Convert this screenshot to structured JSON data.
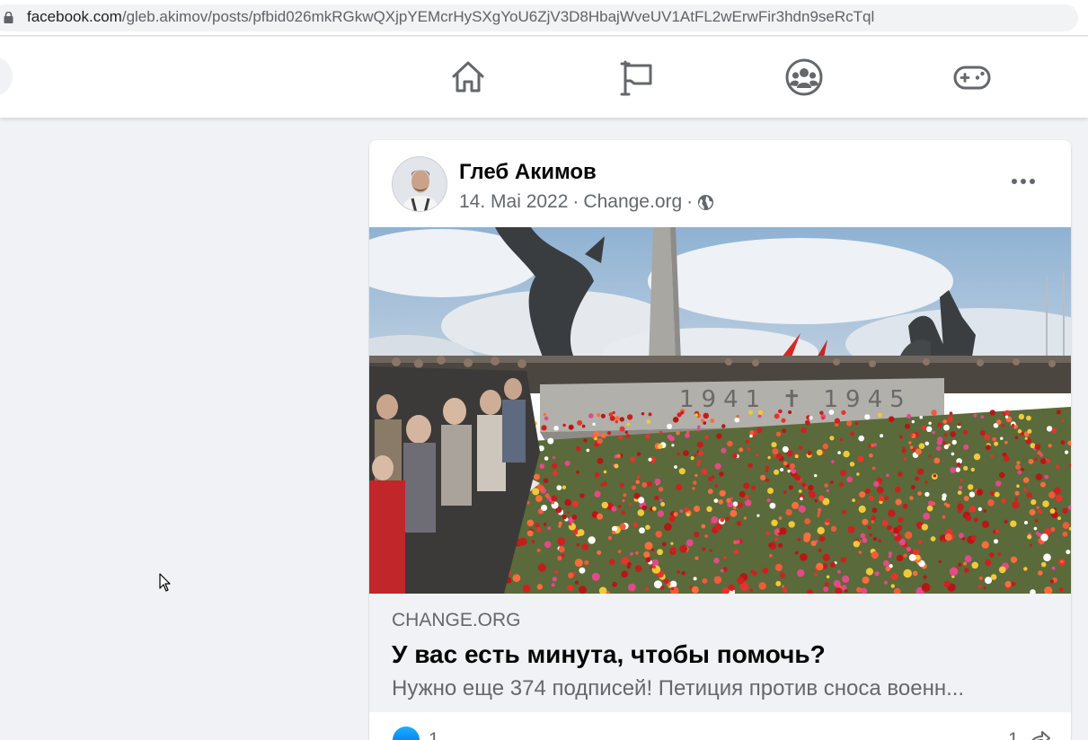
{
  "browser": {
    "url_host": "facebook.com",
    "url_path": "/gleb.akimov/posts/pfbid026mkRGkwQXjpYEMcrHySXgYoU6ZjV3D8HbajWveUV1AtFL2wErwFir3hdn9seRcTql"
  },
  "nav": {
    "icons": [
      "home-icon",
      "pages-flag-icon",
      "groups-icon",
      "gaming-icon"
    ]
  },
  "post": {
    "author": "Глеб Акимов",
    "date": "14. Mai 2022",
    "separator": "·",
    "source": "Change.org",
    "audience_icon": "globe-icon",
    "link": {
      "domain": "CHANGE.ORG",
      "title": "У вас есть минута, чтобы помочь?",
      "description": "Нужно еще 374 подписей! Петиция против сноса военн..."
    },
    "image_inscription": "1941 ✝ 1945",
    "reactions": {
      "like_count": "1",
      "share_count": "1"
    }
  },
  "colors": {
    "page_bg": "#f0f2f5",
    "card_bg": "#ffffff",
    "text_primary": "#050505",
    "text_secondary": "#65676b",
    "like_blue": "#1877f2"
  }
}
